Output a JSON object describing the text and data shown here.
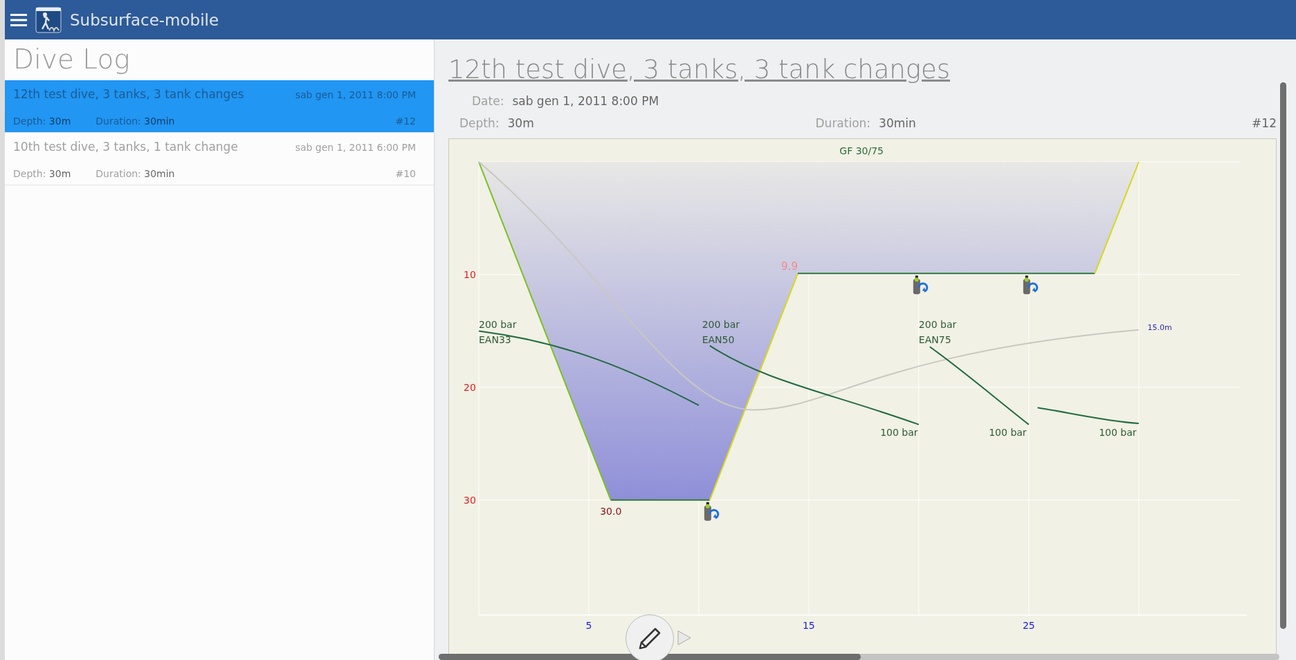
{
  "header": {
    "title": "Subsurface-mobile"
  },
  "dive_list": {
    "title": "Dive Log",
    "dives": [
      {
        "title": "12th test dive, 3 tanks, 3 tank changes",
        "date": "sab gen 1, 2011 8:00 PM",
        "depth_label": "Depth:",
        "depth": "30m",
        "duration_label": "Duration:",
        "duration": "30min",
        "number": "#12",
        "selected": true
      },
      {
        "title": "10th test dive, 3 tanks, 1 tank change",
        "date": "sab gen 1, 2011 6:00 PM",
        "depth_label": "Depth:",
        "depth": "30m",
        "duration_label": "Duration:",
        "duration": "30min",
        "number": "#10",
        "selected": false
      }
    ]
  },
  "dive_details": {
    "title": "12th test dive, 3 tanks, 3 tank changes",
    "date_label": "Date:",
    "date": "sab gen 1, 2011 8:00 PM",
    "depth_label": "Depth:",
    "depth": "30m",
    "duration_label": "Duration:",
    "duration": "30min",
    "number": "#12",
    "chart_data": {
      "type": "area",
      "x": [
        0,
        6,
        10.5,
        14.5,
        28,
        30
      ],
      "series": [
        {
          "color": "#8f8fd9",
          "values": [
            0,
            30,
            30,
            9.9,
            9.9,
            0
          ]
        }
      ],
      "grid": true,
      "xlim": [
        0,
        34.6
      ],
      "ylim": [
        40.2,
        0
      ],
      "xticks": [
        5,
        15,
        25
      ],
      "yticks": [
        10,
        20,
        30
      ],
      "annotations": [
        "GF 30/75",
        "9.9",
        "30.0",
        "200 bar",
        "EAN33",
        "200 bar",
        "EAN50",
        "200 bar",
        "EAN75",
        "100 bar",
        "100 bar",
        "100 bar",
        "15.0m"
      ]
    }
  }
}
